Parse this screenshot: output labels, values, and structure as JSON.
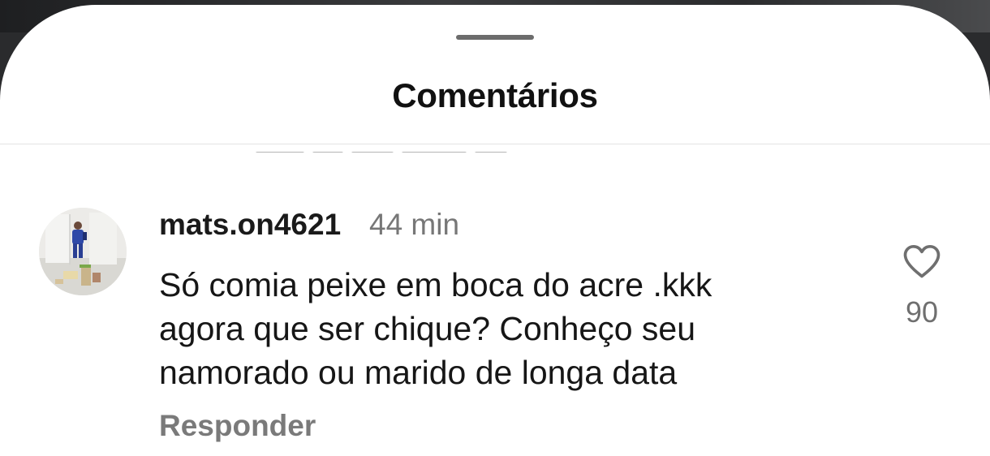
{
  "header": {
    "title": "Comentários"
  },
  "comment": {
    "username": "mats.on4621",
    "time": "44 min",
    "text_lines": [
      "Só comia peixe em boca do acre .kkk",
      "agora que ser chique? Conheço seu",
      "namorado ou marido de longa data"
    ],
    "reply_label": "Responder",
    "like_count": "90",
    "like_icon": "heart-outline-icon",
    "avatar": "profile-photo"
  },
  "colors": {
    "sheet_background": "#ffffff",
    "title_text": "#111111",
    "secondary_text": "#777777",
    "handle": "#6c6c6c",
    "divider": "#e3e3e3"
  }
}
